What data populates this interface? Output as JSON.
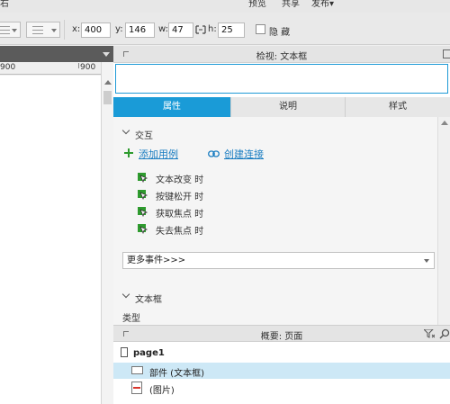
{
  "menubar": {
    "item_right_edge": "右",
    "preview": "预览",
    "share": "共享",
    "publish": "发布▾"
  },
  "toolbar": {
    "x_label": "x:",
    "x_value": "400",
    "y_label": "y:",
    "y_value": "146",
    "w_label": "w:",
    "w_value": "47",
    "h_label": "h:",
    "h_value": "25",
    "hide_label": "隐 藏"
  },
  "ruler": {
    "left_value": "900",
    "right_value": "900"
  },
  "inspector": {
    "title": "检视: 文本框",
    "name_input_value": "",
    "tabs": [
      {
        "label": "属性",
        "active": true
      },
      {
        "label": "说明",
        "active": false
      },
      {
        "label": "样式",
        "active": false
      }
    ],
    "interaction_section": "交互",
    "add_case": "添加用例",
    "create_link": "创建连接",
    "events": [
      "文本改变 时",
      "按键松开 时",
      "获取焦点 时",
      "失去焦点 时"
    ],
    "more_events": "更多事件>>>",
    "textbox_section": "文本框",
    "type_label": "类型"
  },
  "outline": {
    "title": "概要: 页面",
    "items": [
      {
        "label": "page1",
        "type": "page"
      },
      {
        "label": "部件 (文本框)",
        "type": "widget",
        "selected": true
      },
      {
        "label": "(图片)",
        "type": "image"
      }
    ]
  },
  "colors": {
    "accent": "#1a9bd7",
    "link": "#1a7dc1",
    "selection": "#cde8f6",
    "action_green": "#2e9b2e"
  }
}
